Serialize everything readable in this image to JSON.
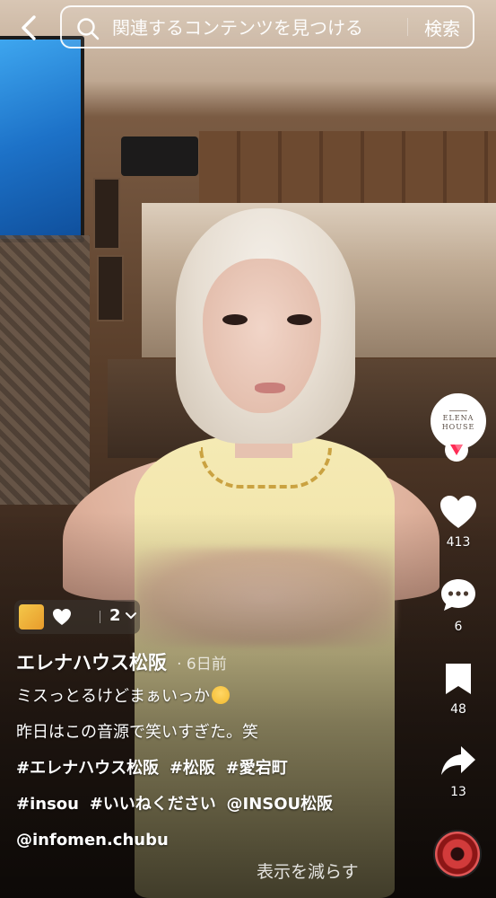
{
  "search": {
    "placeholder": "関連するコンテンツを見つける",
    "button_label": "検索"
  },
  "creator": {
    "avatar_line1": "ELENA",
    "avatar_line2": "HOUSE"
  },
  "actions": {
    "likes": "413",
    "comments": "6",
    "saves": "48",
    "shares": "13"
  },
  "effect": {
    "count": "2"
  },
  "post": {
    "author": "エレナハウス松阪",
    "time": "6日前",
    "caption_line1": "ミスっとるけどまぁいっか",
    "caption_line2": "昨日はこの音源で笑いすぎた。笑",
    "tags_line3": [
      "#エレナハウス松阪",
      "#松阪",
      "#愛宕町"
    ],
    "tags_line4": [
      "#insou",
      "#いいねください",
      "@INSOU松阪"
    ],
    "tags_line5": [
      "@infomen.chubu"
    ],
    "show_less": "表示を減らす"
  },
  "colors": {
    "text": "#ffffff",
    "follow_badge": "#fe2c55",
    "effect_chip_bg": "#3c3732"
  },
  "icons": [
    "back-icon",
    "search-icon",
    "heart-icon",
    "comment-icon",
    "bookmark-icon",
    "share-icon",
    "follow-plus-icon",
    "chevron-down-icon"
  ]
}
